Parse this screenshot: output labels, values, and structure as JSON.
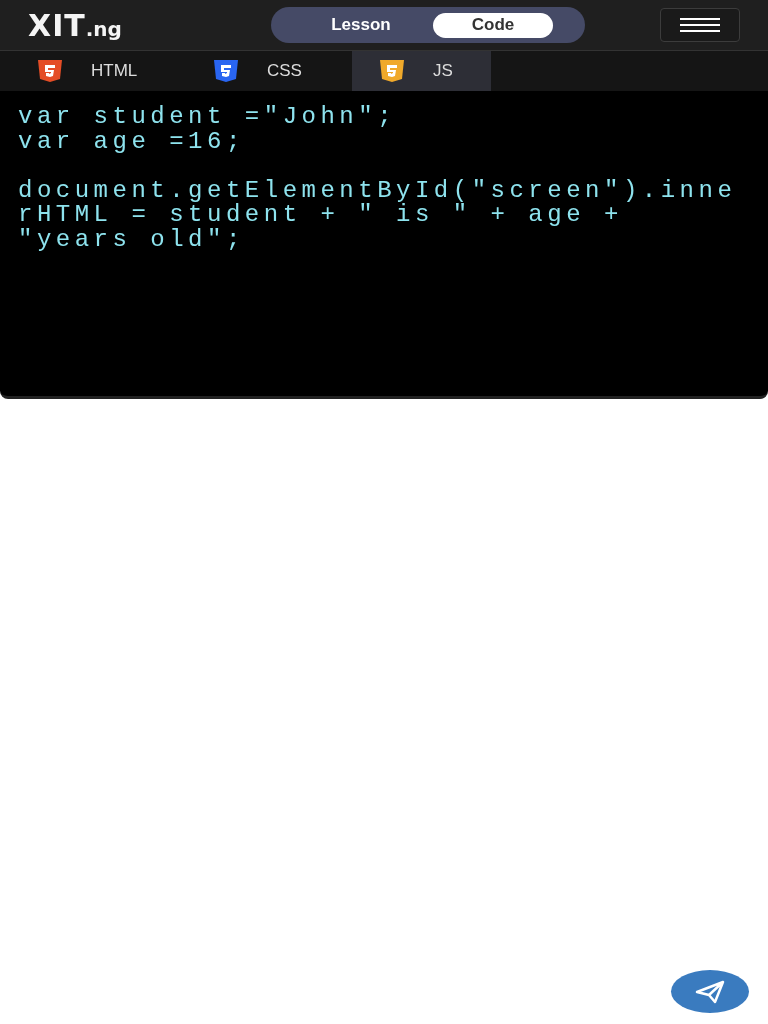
{
  "header": {
    "logo": {
      "main": "XIT",
      "suffix": ".ng"
    },
    "toggle": [
      {
        "label": "Lesson",
        "selected": false
      },
      {
        "label": "Code",
        "selected": true
      }
    ]
  },
  "tabs": [
    {
      "label": "HTML",
      "kind": "html",
      "selected": false
    },
    {
      "label": "CSS",
      "kind": "css",
      "selected": false
    },
    {
      "label": "JS",
      "kind": "js",
      "selected": true
    }
  ],
  "code_blocks": [
    {
      "lines": [
        "var student =\"John\";",
        "var age =16;"
      ]
    },
    {
      "lines": [
        "document.getElementById(\"screen\").inne",
        "rHTML = student + \" is \" + age +",
        "\"years old\";"
      ]
    }
  ]
}
